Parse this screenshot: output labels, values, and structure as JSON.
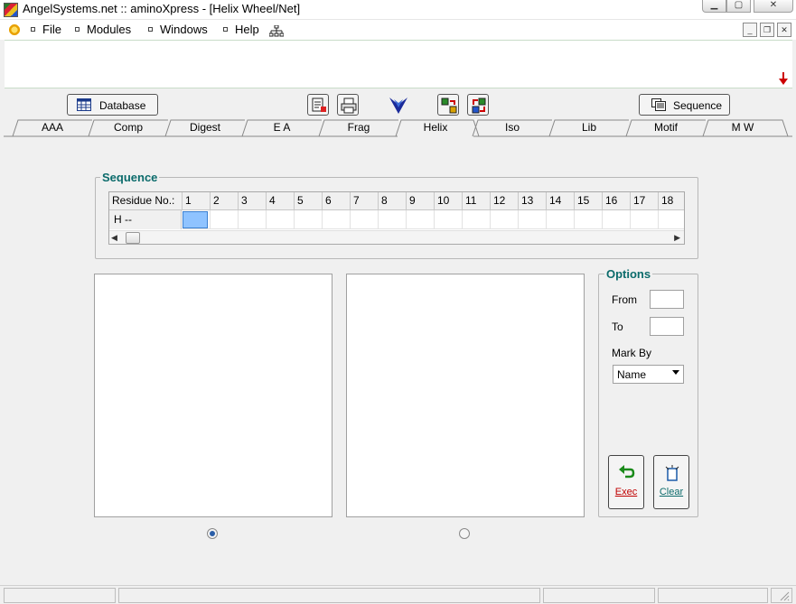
{
  "window": {
    "title": "AngelSystems.net :: aminoXpress - [Helix Wheel/Net]"
  },
  "menu": {
    "items": [
      {
        "label": "File"
      },
      {
        "label": "Modules"
      },
      {
        "label": "Windows"
      },
      {
        "label": "Help"
      }
    ]
  },
  "toolbar": {
    "database_label": "Database",
    "sequence_label": "Sequence"
  },
  "tabs": [
    {
      "label": "AAA"
    },
    {
      "label": "Comp"
    },
    {
      "label": "Digest"
    },
    {
      "label": "E A"
    },
    {
      "label": "Frag"
    },
    {
      "label": "Helix",
      "active": true
    },
    {
      "label": "Iso"
    },
    {
      "label": "Lib"
    },
    {
      "label": "Motif"
    },
    {
      "label": "M W"
    }
  ],
  "sequence": {
    "title": "Sequence",
    "grid": {
      "header_label": "Residue No.:",
      "columns": [
        "1",
        "2",
        "3",
        "4",
        "5",
        "6",
        "7",
        "8",
        "9",
        "10",
        "11",
        "12",
        "13",
        "14",
        "15",
        "16",
        "17",
        "18"
      ],
      "row_label": "H --"
    }
  },
  "options": {
    "title": "Options",
    "from_label": "From",
    "from_value": "",
    "to_label": "To",
    "to_value": "",
    "markby_label": "Mark By",
    "markby_value": "Name",
    "exec_label": "Exec",
    "clear_label": "Clear"
  },
  "radios": {
    "left_selected": true,
    "right_selected": false
  },
  "colors": {
    "group_title": "#0b6b6b",
    "exec_text": "#c00000",
    "selected_cell": "#8fc3ff"
  }
}
